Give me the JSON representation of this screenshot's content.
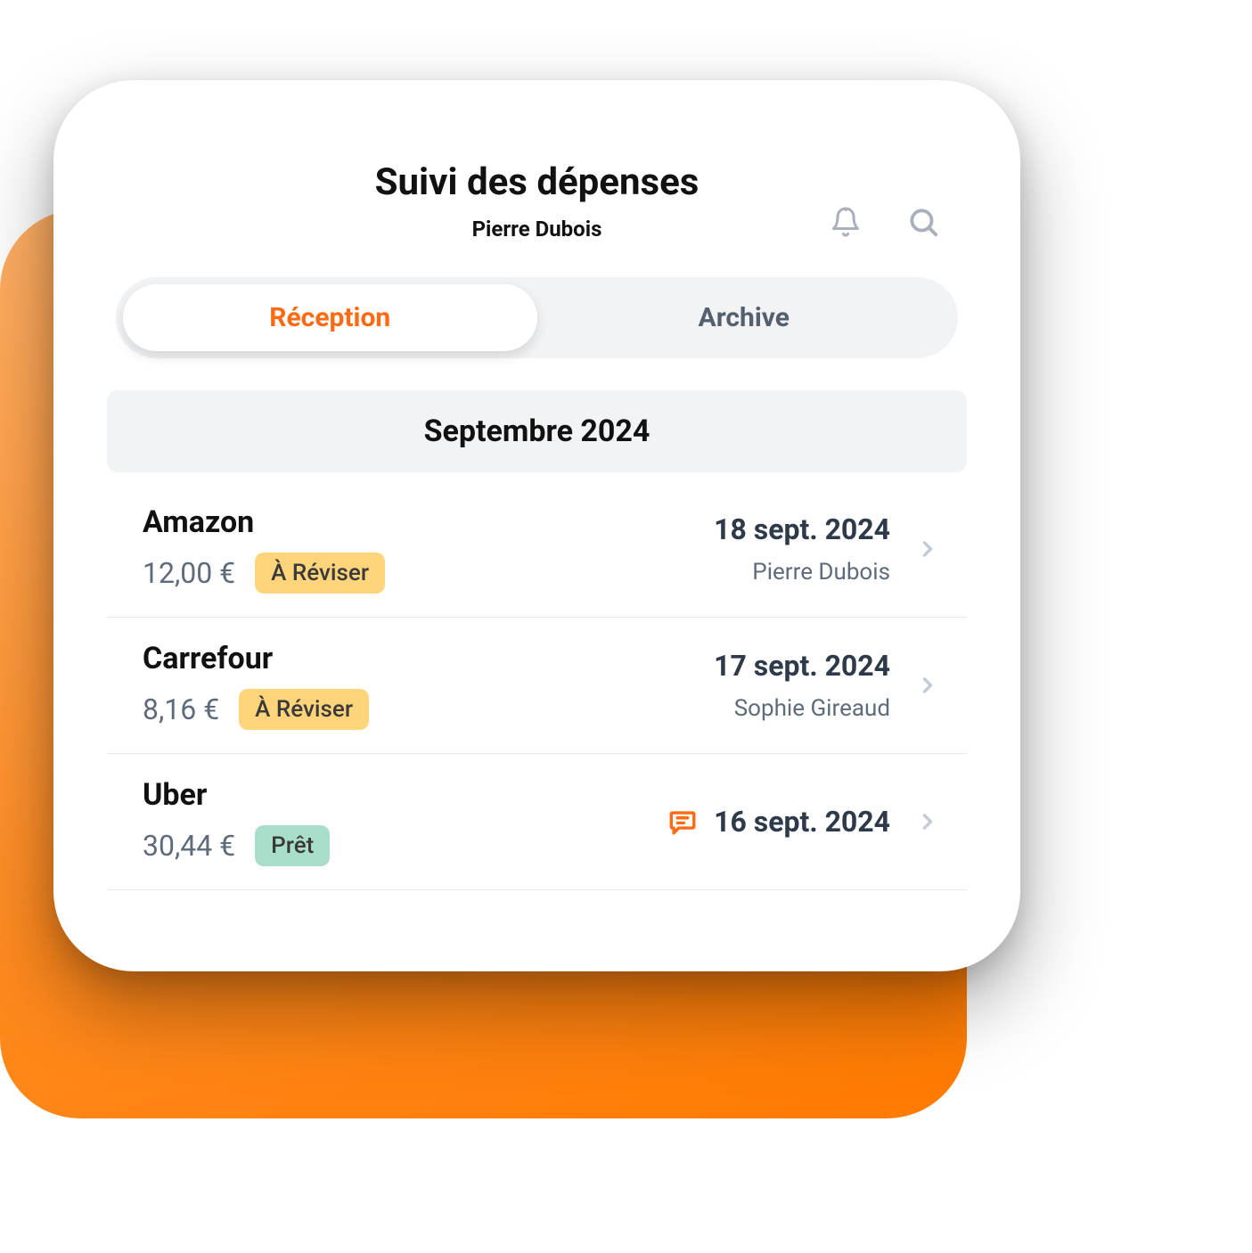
{
  "header": {
    "title": "Suivi des dépenses",
    "subtitle": "Pierre Dubois"
  },
  "tabs": {
    "inbox": "Réception",
    "archive": "Archive"
  },
  "section": {
    "month": "Septembre 2024"
  },
  "expenses": [
    {
      "vendor": "Amazon",
      "amount": "12,00 €",
      "status": "À Réviser",
      "status_kind": "review",
      "date": "18 sept. 2024",
      "person": "Pierre Dubois",
      "has_message": false
    },
    {
      "vendor": "Carrefour",
      "amount": "8,16 €",
      "status": "À Réviser",
      "status_kind": "review",
      "date": "17 sept. 2024",
      "person": "Sophie Gireaud",
      "has_message": false
    },
    {
      "vendor": "Uber",
      "amount": "30,44 €",
      "status": "Prêt",
      "status_kind": "ready",
      "date": "16 sept. 2024",
      "person": "",
      "has_message": true
    }
  ]
}
